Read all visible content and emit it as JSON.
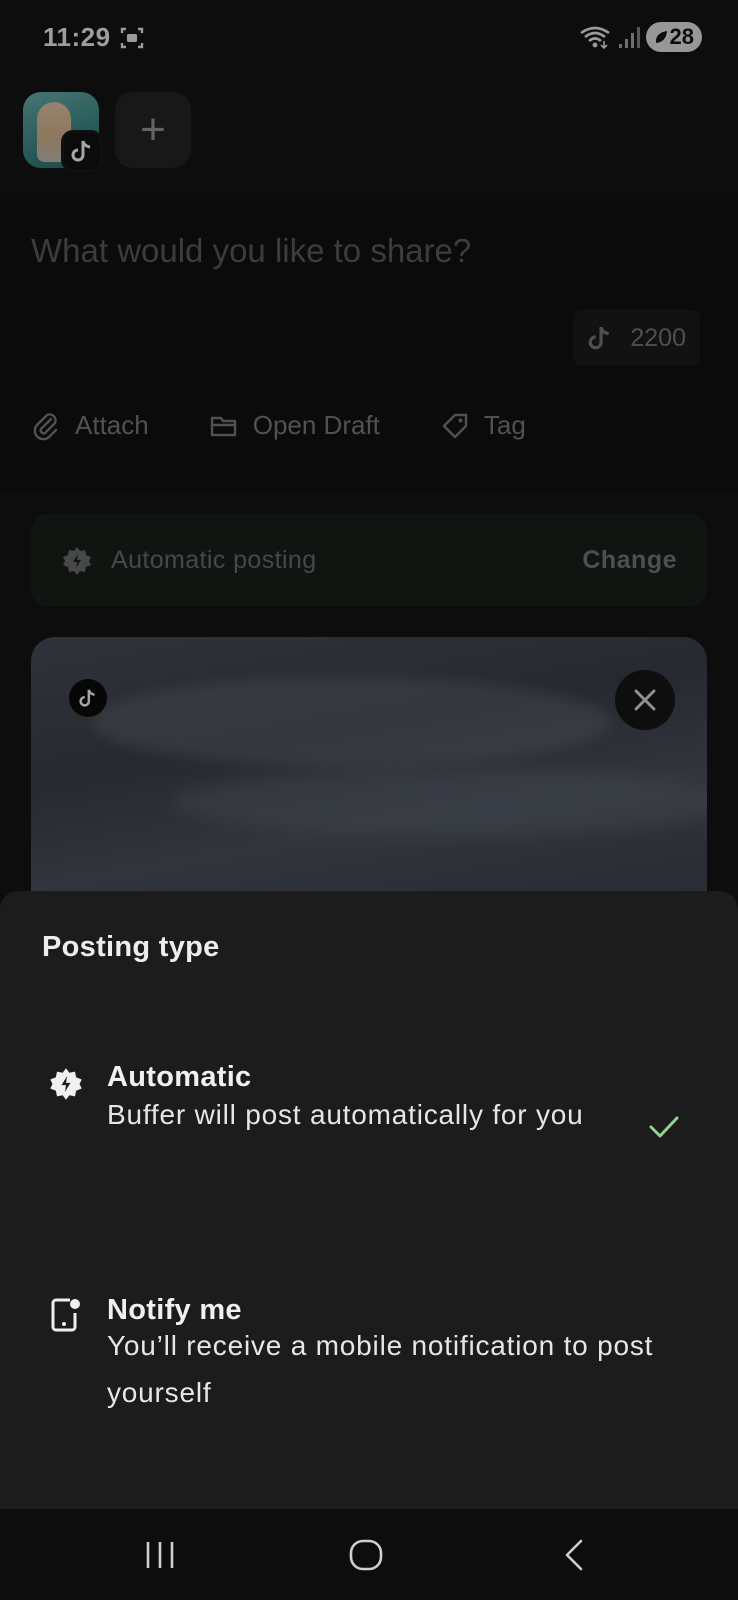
{
  "status_bar": {
    "time": "11:29",
    "battery_level": "28",
    "icons": [
      "screen-record-icon",
      "wifi-icon",
      "signal-icon",
      "battery-saver-icon"
    ]
  },
  "accounts": {
    "items": [
      {
        "network": "tiktok",
        "icon": "tiktok-icon"
      }
    ],
    "add_label": "+"
  },
  "composer": {
    "placeholder": "What would you like to share?",
    "char_counter": "2200",
    "counter_icon": "tiktok-icon"
  },
  "toolbar": {
    "attach": "Attach",
    "open_draft": "Open Draft",
    "tag": "Tag"
  },
  "posting_bar": {
    "label": "Automatic posting",
    "change": "Change",
    "icon": "sparkle-badge-icon"
  },
  "media": {
    "network_icon": "tiktok-icon",
    "remove_icon": "close-icon"
  },
  "sheet": {
    "title": "Posting type",
    "options": [
      {
        "title": "Automatic",
        "description": "Buffer will post automatically for you",
        "icon": "sparkle-badge-icon",
        "selected": true
      },
      {
        "title": "Notify me",
        "description": "You’ll receive a mobile notification to post yourself",
        "icon": "phone-notification-icon",
        "selected": false
      }
    ]
  },
  "nav": {
    "icons": [
      "recents-icon",
      "home-icon",
      "back-icon"
    ]
  },
  "colors": {
    "sheet_bg": "#1c1c1c",
    "check_color": "#8fd48f",
    "posting_bar_bg": "#1a211c"
  }
}
